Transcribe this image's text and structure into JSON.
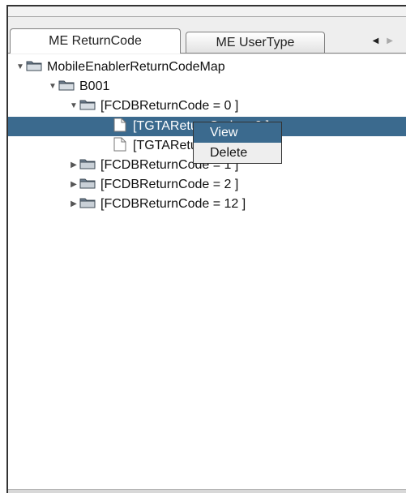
{
  "tabs": [
    {
      "label": "ME ReturnCode",
      "active": true
    },
    {
      "label": "ME UserType",
      "active": false
    }
  ],
  "tab_scroll": {
    "left_icon": "triangle-left",
    "right_icon": "triangle-right"
  },
  "tree": {
    "root": "MobileEnablerReturnCodeMap",
    "b001": "B001",
    "rc0": "[FCDBReturnCode = 0 ]",
    "tgta0": "[TGTAReturnCode = 0 ]",
    "tgta4": "[TGTAReturnCode = 4 ]",
    "rc1": "[FCDBReturnCode = 1 ]",
    "rc2": "[FCDBReturnCode = 2 ]",
    "rc12": "[FCDBReturnCode = 12 ]"
  },
  "context_menu": {
    "view": "View",
    "delete": "Delete"
  },
  "colors": {
    "selection": "#3b6a8e",
    "background": "#eeeeee"
  }
}
